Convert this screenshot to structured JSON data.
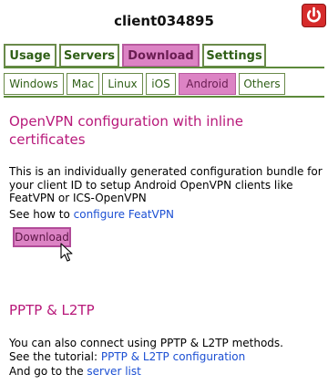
{
  "header": {
    "title": "client034895"
  },
  "main_tabs": [
    {
      "label": "Usage",
      "active": false
    },
    {
      "label": "Servers",
      "active": false
    },
    {
      "label": "Download",
      "active": true
    },
    {
      "label": "Settings",
      "active": false
    }
  ],
  "sub_tabs": [
    {
      "label": "Windows",
      "active": false
    },
    {
      "label": "Mac",
      "active": false
    },
    {
      "label": "Linux",
      "active": false
    },
    {
      "label": "iOS",
      "active": false
    },
    {
      "label": "Android",
      "active": true
    },
    {
      "label": "Others",
      "active": false
    }
  ],
  "openvpn": {
    "title": "OpenVPN configuration with inline certificates",
    "description": "This is an individually generated configuration bundle for your client ID to setup Android OpenVPN clients like FeatVPN or ICS-OpenVPN",
    "see_how_prefix": "See how to ",
    "see_how_link": "configure FeatVPN",
    "download_label": "Download"
  },
  "pptp": {
    "title": "PPTP & L2TP",
    "line1": "You can also connect using PPTP & L2TP methods.",
    "tutorial_prefix": "See the tutorial: ",
    "tutorial_link": "PPTP & L2TP configuration",
    "server_prefix": "And go to the ",
    "server_link": "server list"
  },
  "colors": {
    "accent_pink": "#dc83c4",
    "tab_green": "#2f5f16",
    "section_title": "#b8197a",
    "link": "#1b4fd3",
    "power_red": "#d62b2b"
  },
  "icons": [
    "power-icon",
    "mouse-pointer-icon"
  ]
}
